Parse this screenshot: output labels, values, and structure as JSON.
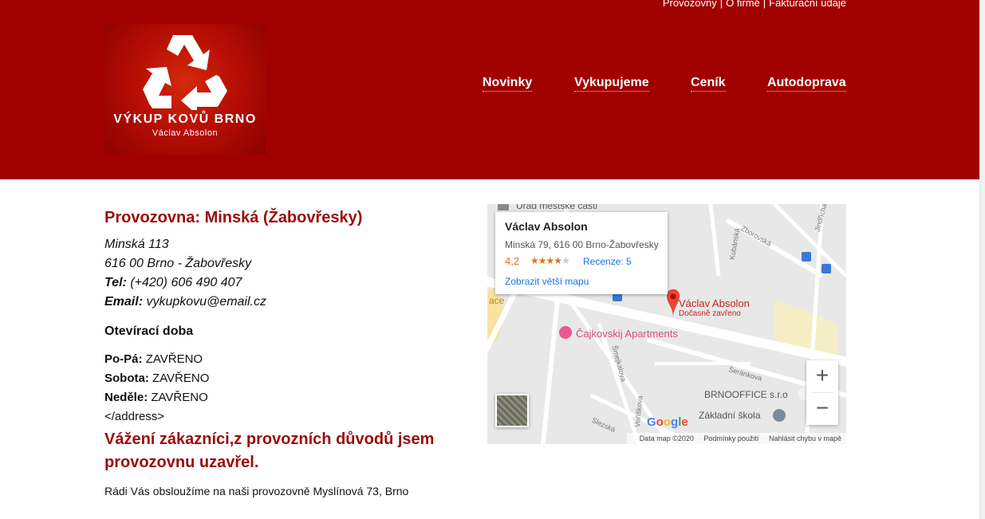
{
  "top_links": {
    "item1": "Provozovny",
    "sep": "|",
    "item2": "O firmě",
    "item3": "Fakturační údaje"
  },
  "logo": {
    "title": "VÝKUP KOVŮ BRNO",
    "subtitle": "Václav Absolon"
  },
  "nav": [
    {
      "label": "Novinky"
    },
    {
      "label": "Vykupujeme"
    },
    {
      "label": "Ceník"
    },
    {
      "label": "Autodoprava"
    }
  ],
  "colors": {
    "header_bg": "#a10000",
    "accent_text": "#9b0b0b"
  },
  "content": {
    "title": "Provozovna: Minská (Žabovřesky)",
    "street": "Minská 113",
    "city": "616 00 Brno - Žabovřesky",
    "tel_label": "Tel:",
    "tel_value": "(+420) 606 490 407",
    "email_label": "Email:",
    "email_value": "vykupkovu@email.cz",
    "hours_title": "Otevírací doba",
    "hours": [
      {
        "day": "Po-Pá:",
        "value": "ZAVŘENO"
      },
      {
        "day": "Sobota:",
        "value": "ZAVŘENO"
      },
      {
        "day": "Neděle:",
        "value": "ZAVŘENO"
      }
    ],
    "address_tag": "</address>",
    "notice": "Vážení zákazníci,z provozních důvodů jsem provozovnu uzavřel.",
    "note": "Rádi Vás obsloužíme na naši provozovně Myslínová 73, Brno"
  },
  "map": {
    "info_name": "Václav Absolon",
    "info_address": "Minská 79, 616 00 Brno-Žabovřesky",
    "rating": "4,2",
    "stars_full": "★★★★",
    "stars_empty": "★",
    "reviews": "Recenze: 5",
    "larger_map": "Zobrazit větší mapu",
    "pin_name": "Václav Absolon",
    "pin_status": "Dočasně zavřeno",
    "poi_apartments": "Čajkovskij Apartments",
    "poi_office": "BRNOOFFICE s.r.o",
    "poi_school": "Základní škola",
    "poi_urad": "Úřad městské části",
    "poi_ace": "ace",
    "streets": [
      "Kubánská",
      "Zborovská",
      "Jindřicha",
      "Šmejkalova",
      "Šeránkova",
      "Slezská",
      "Voříškova"
    ],
    "zoom_in": "+",
    "zoom_out": "−",
    "footer_data": "Data map ©2020",
    "footer_terms": "Podmínky použití",
    "footer_report": "Nahlásit chybu v mapě",
    "google": {
      "g1": "G",
      "o1": "o",
      "o2": "o",
      "g2": "g",
      "l": "l",
      "e": "e"
    }
  }
}
